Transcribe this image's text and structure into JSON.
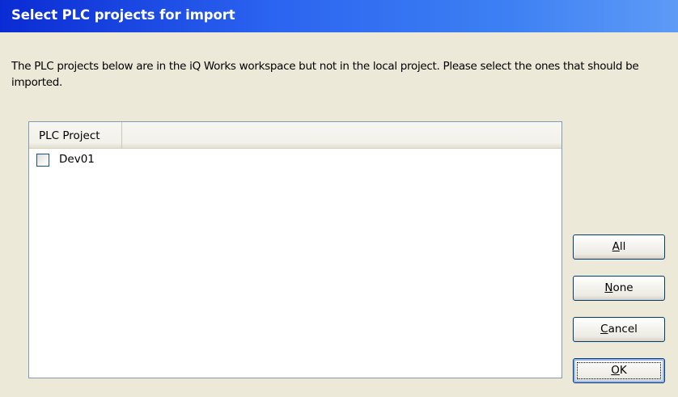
{
  "dialog": {
    "title": "Select PLC projects for import",
    "description": "The PLC projects below are in the iQ Works workspace but not in the local project. Please select the ones that should be imported."
  },
  "list": {
    "column_header": "PLC Project",
    "items": [
      {
        "label": "Dev01",
        "checked": false
      }
    ]
  },
  "buttons": {
    "all": {
      "mnemonic": "A",
      "rest": "ll"
    },
    "none": {
      "mnemonic": "N",
      "rest": "one"
    },
    "cancel": {
      "mnemonic": "C",
      "rest": "ancel"
    },
    "ok": {
      "mnemonic": "O",
      "rest": "K"
    }
  },
  "colors": {
    "title_bar_start": "#0a2bd3",
    "title_bar_end": "#5e9bf6",
    "dialog_background": "#ece9d8",
    "button_border": "#003c74"
  }
}
